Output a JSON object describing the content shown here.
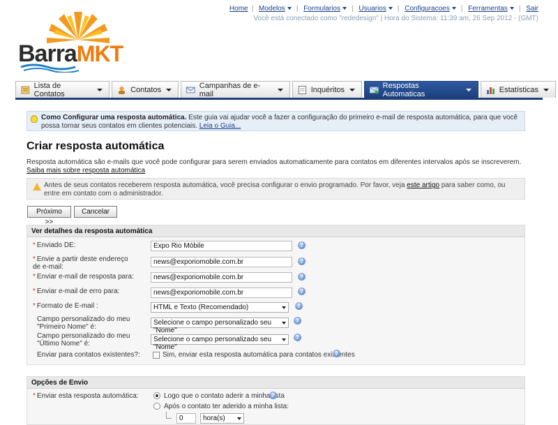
{
  "logo": {
    "brand1": "Barra",
    "brand2": "MKT"
  },
  "topnav": {
    "items": [
      "Home",
      "Modelos",
      "Formularios",
      "Usuarios",
      "Configuracoes",
      "Ferramentas",
      "Sair"
    ],
    "session_info": "Você está conectado como \"rededesign\" | Hora do Sistema: 11:39 am, 26 Sep 2012 - (GMT)"
  },
  "tabs": [
    {
      "label": "Lista de Contatos",
      "icon": "contact-list-icon"
    },
    {
      "label": "Contatos",
      "icon": "contacts-icon"
    },
    {
      "label": "Campanhas de e-mail",
      "icon": "email-icon"
    },
    {
      "label": "Inquéritos",
      "icon": "survey-icon"
    },
    {
      "label": "Respostas Automaticas",
      "icon": "autoresponder-icon",
      "active": true
    },
    {
      "label": "Estatísticas",
      "icon": "chart-icon"
    }
  ],
  "guide": {
    "title": "Como Configurar uma resposta automática.",
    "text": " Este guia vai ajudar você a fazer a configuração do primeiro e-mail de resposta automática, para que você possa tornar seus contatos em clientes potenciais.",
    "link": "Leia o Guia..."
  },
  "page": {
    "title": "Criar resposta automática",
    "description": "Resposta automática são e-mails que você pode configurar para serem enviados automaticamente para contatos em diferentes intervalos após se inscreverem.",
    "description_link": "Saiba mais sobre resposta automática",
    "warning_pre": "Antes de seus contatos receberem resposta automática, você precisa configurar o envio programado. Por favor, veja ",
    "warning_link": "este artigo",
    "warning_post": " para saber como, ou entre em contato com o administrador."
  },
  "buttons": {
    "next": "Próximo >>",
    "cancel": "Cancelar"
  },
  "details": {
    "title": "Ver detalhes da resposta automática",
    "from_label": "Enviado DE:",
    "from_value": "Expo Rio Móbile",
    "from_email_label": "Envie a partir deste endereço de e-mail:",
    "from_email_value": "news@exporiomobile.com.br",
    "reply_label": "Enviar e-mail de resposta para:",
    "reply_value": "news@exporiomobile.com.br",
    "bounce_label": "Enviar e-mail de erro para:",
    "bounce_value": "news@exporiomobile.com.br",
    "format_label": "Formato de E-mail :",
    "format_value": "HTML e Texto (Recomendado)",
    "firstname_label": "Campo personalizado do meu \"Primeiro Nome\" é:",
    "firstname_value": "Selecione o campo personalizado seu \"Nome\"",
    "lastname_label": "Campo personalizado do meu \"Último Nome\" é:",
    "lastname_value": "Selecione o campo personalizado seu \"Nome\"",
    "existing_label": "Enviar para contatos existentes?:",
    "existing_option": "Sim, enviar esta resposta automática para contatos existentes"
  },
  "send": {
    "title": "Opções de Envio",
    "label": "Enviar esta resposta automática:",
    "option1": "Logo que o contato aderir a minha lista",
    "option2": "Após o contato ter aderido a minha lista:",
    "delay_value": "0",
    "delay_unit": "hora(s)"
  },
  "colors": {
    "tab_active": "#1b3f7c",
    "brand_orange": "#f07b0c",
    "link": "#1a3f88"
  }
}
